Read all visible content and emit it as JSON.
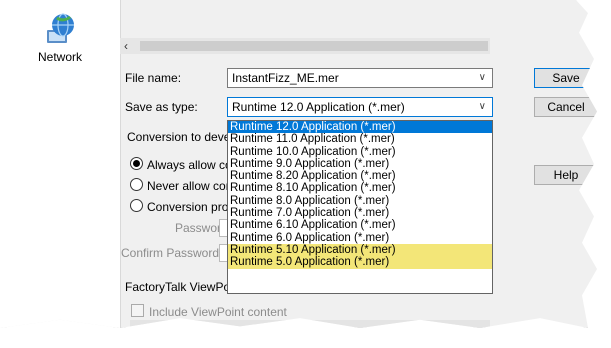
{
  "left_panel": {
    "network_label": "Network"
  },
  "file": {
    "file_name_label": "File name:",
    "file_name_value": "InstantFizz_ME.mer",
    "save_as_type_label": "Save as type:",
    "save_as_type_value": "Runtime 12.0 Application (*.mer)"
  },
  "buttons": {
    "save": "Save",
    "cancel": "Cancel",
    "help": "Help"
  },
  "conversion": {
    "group_label": "Conversion to deve",
    "options": [
      "Always allow co",
      "Never allow cor",
      "Conversion prot"
    ],
    "password_label": "Password:",
    "confirm_password_label": "Confirm Password:"
  },
  "viewpoint": {
    "group_label": "FactoryTalk ViewPo",
    "include_label": "Include ViewPoint content"
  },
  "dropdown": {
    "items": [
      "Runtime 12.0 Application (*.mer)",
      "Runtime 11.0 Application (*.mer)",
      "Runtime 10.0 Application (*.mer)",
      "Runtime 9.0 Application (*.mer)",
      "Runtime 8.20 Application (*.mer)",
      "Runtime 8.10 Application (*.mer)",
      "Runtime 8.0 Application (*.mer)",
      "Runtime 7.0 Application (*.mer)",
      "Runtime 6.10 Application (*.mer)",
      "Runtime 6.0 Application (*.mer)",
      "Runtime 5.10 Application (*.mer)",
      "Runtime 5.0 Application (*.mer)"
    ],
    "selected_index": 0,
    "highlighted_indices": [
      10,
      11
    ]
  },
  "colors": {
    "selection": "#0078d7",
    "highlight": "#f3e678"
  }
}
